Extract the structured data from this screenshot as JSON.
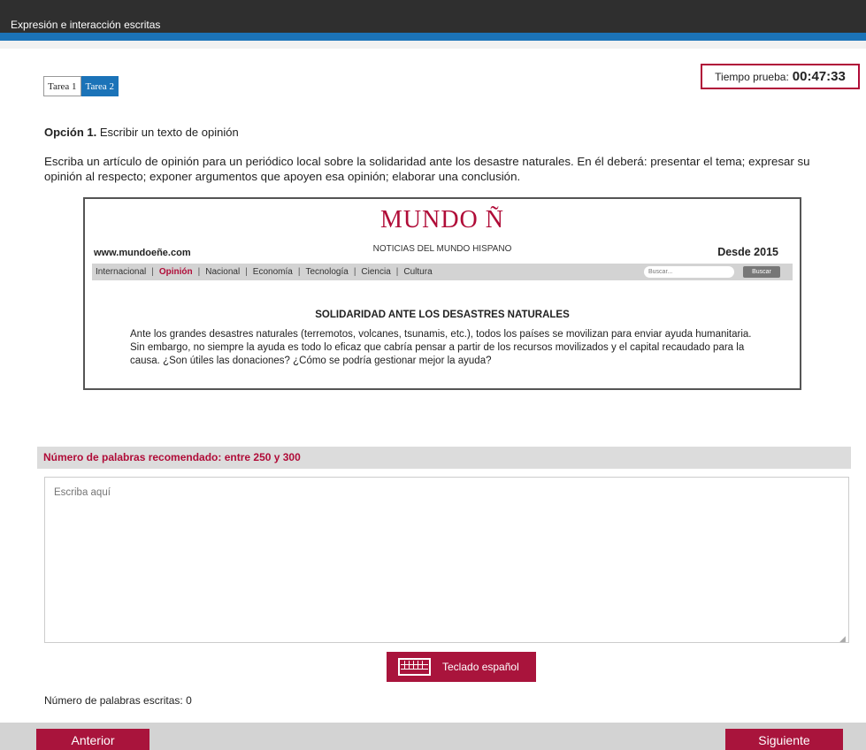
{
  "header": {
    "title": "Expresión e interacción escritas"
  },
  "tabs": [
    {
      "label": "Tarea 1",
      "active": false
    },
    {
      "label": "Tarea 2",
      "active": true
    }
  ],
  "timer": {
    "label": "Tiempo prueba:",
    "value": "00:47:33"
  },
  "task": {
    "option_label": "Opción 1.",
    "option_text": "Escribir un texto de opinión",
    "instructions": "Escriba un artículo de opinión para un periódico local sobre la solidaridad ante los desastre naturales. En él deberá: presentar el tema; expresar su opinión al respecto; exponer argumentos que apoyen esa opinión; elaborar una conclusión."
  },
  "newspaper": {
    "logo": "MUNDO Ñ",
    "subtitle": "NOTICIAS DEL MUNDO HISPANO",
    "url": "www.mundoeñe.com",
    "since": "Desde 2015",
    "nav": [
      "Internacional",
      "Opinión",
      "Nacional",
      "Economía",
      "Tecnología",
      "Ciencia",
      "Cultura"
    ],
    "search_placeholder": "Buscar...",
    "search_button": "Buscar",
    "headline": "SOLIDARIDAD ANTE LOS DESASTRES NATURALES",
    "body": "Ante los grandes desastres naturales (terremotos, volcanes, tsunamis, etc.), todos los países se movilizan para enviar ayuda humanitaria. Sin embargo, no siempre la ayuda es todo lo eficaz que cabría pensar a partir de los recursos movilizados y el capital recaudado para la causa. ¿Son útiles las donaciones? ¿Cómo se podría gestionar mejor la ayuda?"
  },
  "editor": {
    "recommended": "Número de palabras recomendado: entre 250 y 300",
    "placeholder": "Escriba aquí",
    "keyboard_button": "Teclado español",
    "written_count": "Número de palabras escritas: 0"
  },
  "footer": {
    "prev": "Anterior",
    "next": "Siguiente"
  },
  "colors": {
    "accent": "#a9143c",
    "blue": "#1b73b8",
    "header": "#2f2f2f"
  }
}
